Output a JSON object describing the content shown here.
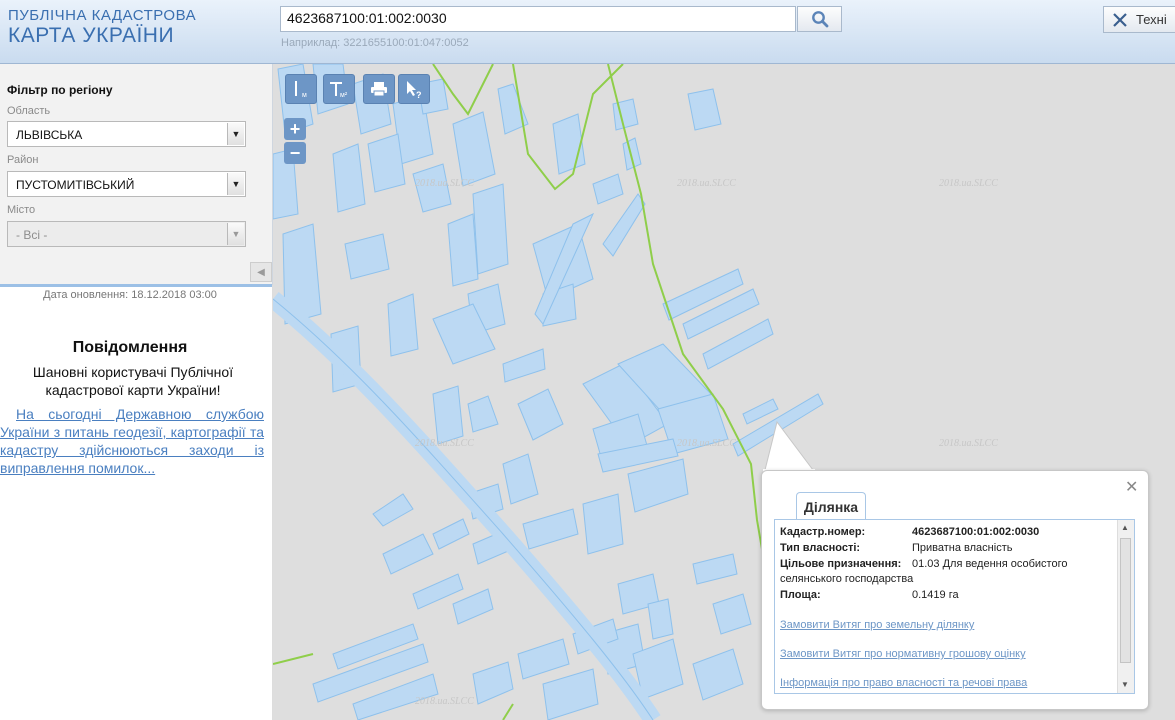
{
  "header": {
    "logo_line1": "ПУБЛІЧНА КАДАСТРОВА",
    "logo_line2": "КАРТА УКРАЇНИ",
    "search_value": "4623687100:01:002:0030",
    "search_hint": "Наприклад: 3221655100:01:047:0052",
    "tech_label": "Техні"
  },
  "filter": {
    "title": "Фільтр по регіону",
    "region_label": "Область",
    "region_value": "ЛЬВІВСЬКА",
    "district_label": "Район",
    "district_value": "ПУСТОМИТІВСЬКИЙ",
    "city_label": "Місто",
    "city_value": "- Всі -"
  },
  "news": {
    "update_date": "Дата оновлення: 18.12.2018 03:00",
    "title": "Повідомлення",
    "greeting": "Шановні користувачі Публічної кадастрової карти України!",
    "link_text": "На сьогодні Державною службою України з питань геодезії, картографії та кадастру здійснюються заходи із виправлення помилок..."
  },
  "map": {
    "watermark": "2018.ua.SLCC",
    "tools": {
      "ruler_sub": "м",
      "area_sub": "м²"
    }
  },
  "popup": {
    "tab": "Ділянка",
    "rows": [
      {
        "key": "Кадастр.номер:",
        "value": "4623687100:01:002:0030"
      },
      {
        "key": "Тип власності:",
        "value": "Приватна власність"
      },
      {
        "key": "Цільове призначення:",
        "value": "01.03 Для ведення особистого"
      },
      {
        "key": "",
        "value": "селянського господарства"
      },
      {
        "key": "Площа:",
        "value": "0.1419 га"
      }
    ],
    "links": [
      "Замовити Витяг про земельну ділянку",
      "Замовити Витяг про нормативну грошову оцінку",
      "Інформація про право власності та речові права"
    ]
  },
  "colors": {
    "accent": "#6d96c6",
    "parcel_fill": "#bcd9f3",
    "parcel_stroke": "#8ec1ec",
    "boundary": "#8fce4a"
  }
}
